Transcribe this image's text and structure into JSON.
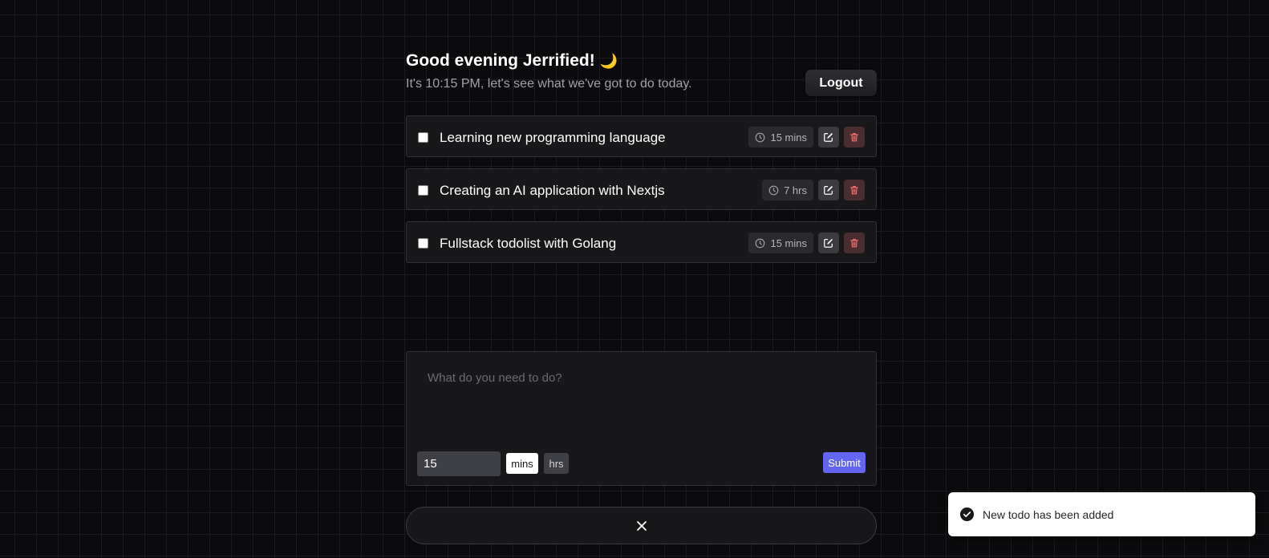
{
  "header": {
    "greeting": "Good evening Jerrified!",
    "greeting_emoji": "🌙",
    "subtitle": "It's 10:15 PM, let's see what we've got to do today.",
    "logout_label": "Logout"
  },
  "todos": [
    {
      "title": "Learning new programming language",
      "duration": "15 mins",
      "checked": false
    },
    {
      "title": "Creating an AI application with Nextjs",
      "duration": "7 hrs",
      "checked": false
    },
    {
      "title": "Fullstack todolist with Golang",
      "duration": "15 mins",
      "checked": false
    }
  ],
  "composer": {
    "placeholder": "What do you need to do?",
    "amount_value": "15",
    "unit_mins": "mins",
    "unit_hrs": "hrs",
    "selected_unit": "mins",
    "submit_label": "Submit"
  },
  "close_icon": "close-icon",
  "toast": {
    "message": "New todo has been added",
    "icon": "check-circle-icon"
  },
  "colors": {
    "accent": "#6366f1",
    "background": "#0b0b0d",
    "card": "#18181b",
    "delete_tint": "#4a2d2f"
  }
}
